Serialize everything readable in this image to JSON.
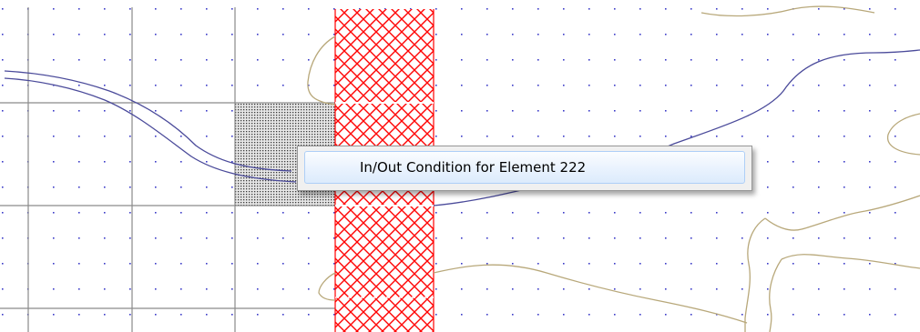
{
  "context_menu": {
    "items": [
      {
        "label": "In/Out Condition for Element 222"
      }
    ]
  },
  "colors": {
    "grid_line": "#8a8a8a",
    "dot": "#3b3bc8",
    "hatch": "#ff0000",
    "stipple": "#555555",
    "channel_line": "#4a4a9a",
    "contour_line": "#b8a87a",
    "menu_bg": "#f0f0f0",
    "menu_border": "#979797",
    "item_highlight_border": "#aecff7"
  },
  "icons": [
    "context-menu"
  ]
}
